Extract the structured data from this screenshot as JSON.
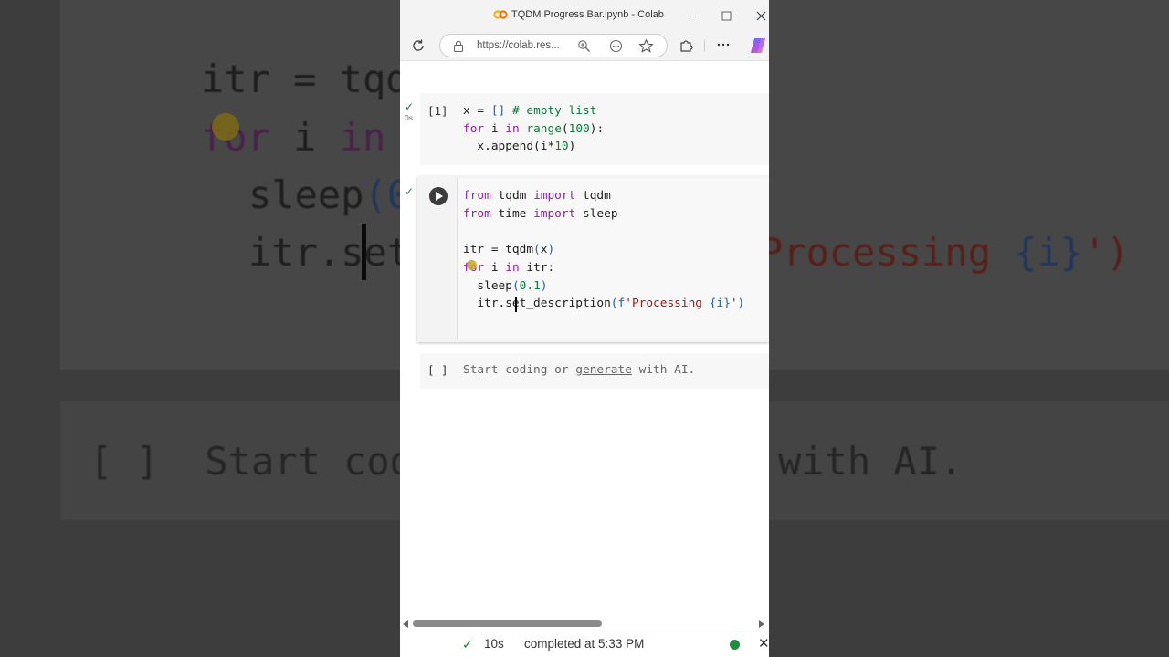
{
  "background": {
    "line1": "itr = tqd",
    "line2_kw": "for",
    "line2_rest": " i ",
    "line2_kw2": "in",
    "line3_fn": "sleep",
    "line3_br": "(0",
    "line4": "itr.set",
    "line4_right_str": "Processing ",
    "line4_right_br": "{i}",
    "line4_right_end": "')",
    "placeholder_left": "[ ]  Start cod",
    "placeholder_right": "with AI."
  },
  "window": {
    "title": "TQDM Progress Bar.ipynb - Colab",
    "url": "https://colab.res..."
  },
  "cells": {
    "cell1": {
      "exec_count": "[1]",
      "timer": "0s",
      "lines": {
        "l1_a": "x = ",
        "l1_b": "[]",
        "l1_c": " # empty list",
        "l2_kw": "for",
        "l2_a": " i ",
        "l2_kw2": "in",
        "l2_fn": " range",
        "l2_b": "(",
        "l2_num": "100",
        "l2_c": "):",
        "l3_a": "  x.append",
        "l3_b": "(",
        "l3_c": "i*",
        "l3_num": "10",
        "l3_d": ")"
      }
    },
    "cell2": {
      "lines": {
        "l1_kw": "from",
        "l1_a": " tqdm ",
        "l1_kw2": "import",
        "l1_b": " tqdm",
        "l2_kw": "from",
        "l2_a": " time ",
        "l2_kw2": "import",
        "l2_b": " sleep",
        "l4_a": "itr = tqdm",
        "l4_b": "(",
        "l4_c": "x",
        "l4_d": ")",
        "l5_kw": "for",
        "l5_a": " i ",
        "l5_kw2": "in",
        "l5_b": " itr:",
        "l6_a": "  sleep",
        "l6_b": "(",
        "l6_num": "0.1",
        "l6_c": ")",
        "l7_a": "  itr.set_description",
        "l7_b": "(",
        "l7_c": "f",
        "l7_str": "'Processing ",
        "l7_br": "{i}",
        "l7_str2": "'",
        "l7_d": ")"
      }
    },
    "cell3": {
      "exec_count": "[ ]",
      "placeholder_a": "Start coding or ",
      "placeholder_link": "generate",
      "placeholder_b": " with AI."
    }
  },
  "status": {
    "duration": "10s",
    "message": "completed at 5:33 PM"
  },
  "colors": {
    "keyword": "#9020a8",
    "number": "#0b7a3b",
    "string": "#a31515",
    "success": "#188038"
  }
}
